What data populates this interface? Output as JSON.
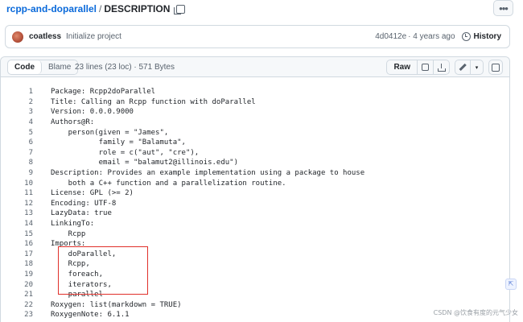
{
  "breadcrumb": {
    "repo": "rcpp-and-doparallel",
    "separator": "/",
    "file": "DESCRIPTION"
  },
  "more_button": {
    "label": "•••"
  },
  "commit": {
    "author": "coatless",
    "message": "Initialize project",
    "sha": "4d0412e",
    "time": "· 4 years ago",
    "history_label": "History"
  },
  "file_header": {
    "tabs": [
      {
        "label": "Code",
        "active": true
      },
      {
        "label": "Blame",
        "active": false
      }
    ],
    "meta": "23 lines (23 loc) · 571 Bytes",
    "raw_label": "Raw",
    "caret": "▾"
  },
  "code": {
    "lines": [
      {
        "n": "1",
        "text": "Package: Rcpp2doParallel"
      },
      {
        "n": "2",
        "text": "Title: Calling an Rcpp function with doParallel"
      },
      {
        "n": "3",
        "text": "Version: 0.0.0.9000"
      },
      {
        "n": "4",
        "text": "Authors@R:"
      },
      {
        "n": "5",
        "text": "    person(given = \"James\","
      },
      {
        "n": "6",
        "text": "           family = \"Balamuta\","
      },
      {
        "n": "7",
        "text": "           role = c(\"aut\", \"cre\"),"
      },
      {
        "n": "8",
        "text": "           email = \"balamut2@illinois.edu\")"
      },
      {
        "n": "9",
        "text": "Description: Provides an example implementation using a package to house"
      },
      {
        "n": "10",
        "text": "    both a C++ function and a parallelization routine."
      },
      {
        "n": "11",
        "text": "License: GPL (>= 2)"
      },
      {
        "n": "12",
        "text": "Encoding: UTF-8"
      },
      {
        "n": "13",
        "text": "LazyData: true"
      },
      {
        "n": "14",
        "text": "LinkingTo:"
      },
      {
        "n": "15",
        "text": "    Rcpp"
      },
      {
        "n": "16",
        "text": "Imports:"
      },
      {
        "n": "17",
        "text": "    doParallel,"
      },
      {
        "n": "18",
        "text": "    Rcpp,"
      },
      {
        "n": "19",
        "text": "    foreach,"
      },
      {
        "n": "20",
        "text": "    iterators,"
      },
      {
        "n": "21",
        "text": "    parallel"
      },
      {
        "n": "22",
        "text": "Roxygen: list(markdown = TRUE)"
      },
      {
        "n": "23",
        "text": "RoxygenNote: 6.1.1"
      }
    ]
  },
  "side_widget": {
    "label": "⇱"
  },
  "watermark": "CSDN @饮食有度的元气少女",
  "colors": {
    "link": "#0969da",
    "highlight_box": "#e0302a",
    "border": "#d1d9e0",
    "header_bg": "#f6f8fa"
  }
}
